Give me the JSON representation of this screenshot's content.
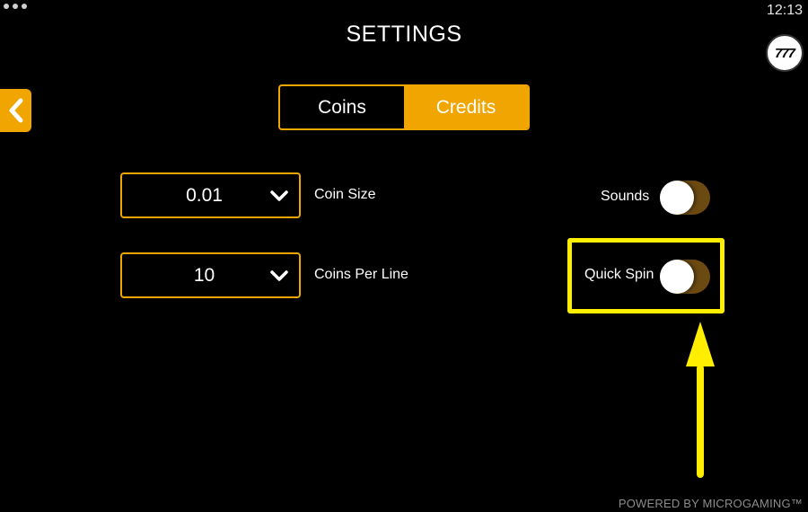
{
  "status_bar": {
    "time": "12:13"
  },
  "header": {
    "title": "SETTINGS",
    "logo_text": "777"
  },
  "nav": {
    "back_icon": "chevron-left-icon"
  },
  "mode_tabs": [
    {
      "label": "Coins",
      "active": false
    },
    {
      "label": "Credits",
      "active": true
    }
  ],
  "coin_size": {
    "value": "0.01",
    "label": "Coin Size"
  },
  "coins_per_line": {
    "value": "10",
    "label": "Coins Per Line"
  },
  "sounds": {
    "label": "Sounds",
    "enabled": false
  },
  "quick_spin": {
    "label": "Quick Spin",
    "enabled": false
  },
  "footer": {
    "text": "POWERED BY MICROGAMING™"
  },
  "colors": {
    "accent": "#f0a500",
    "highlight": "#ffee00",
    "toggle_track": "#6b4a12",
    "background": "#000000"
  }
}
